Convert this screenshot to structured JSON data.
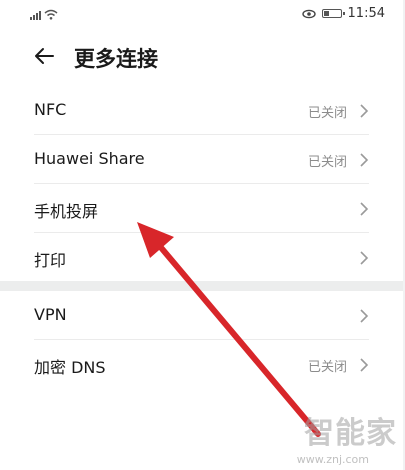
{
  "status_bar": {
    "time": "11:54",
    "signal_icon": "signal-icon",
    "wifi_icon": "wifi-icon",
    "eye_icon": "eye-comfort-icon",
    "battery_icon": "battery-icon"
  },
  "header": {
    "title": "更多连接",
    "back_icon": "back-arrow-icon"
  },
  "list": [
    {
      "label": "NFC",
      "status": "已关闭"
    },
    {
      "label": "Huawei Share",
      "status": "已关闭"
    },
    {
      "label": "手机投屏",
      "status": ""
    },
    {
      "label": "打印",
      "status": ""
    },
    {
      "label": "VPN",
      "status": ""
    },
    {
      "label": "加密 DNS",
      "status": "已关闭"
    }
  ],
  "annotation": {
    "arrow_color": "#d8262a",
    "points_to": "手机投屏"
  },
  "watermark": {
    "text": "智能家",
    "url": "www.znj.com"
  }
}
